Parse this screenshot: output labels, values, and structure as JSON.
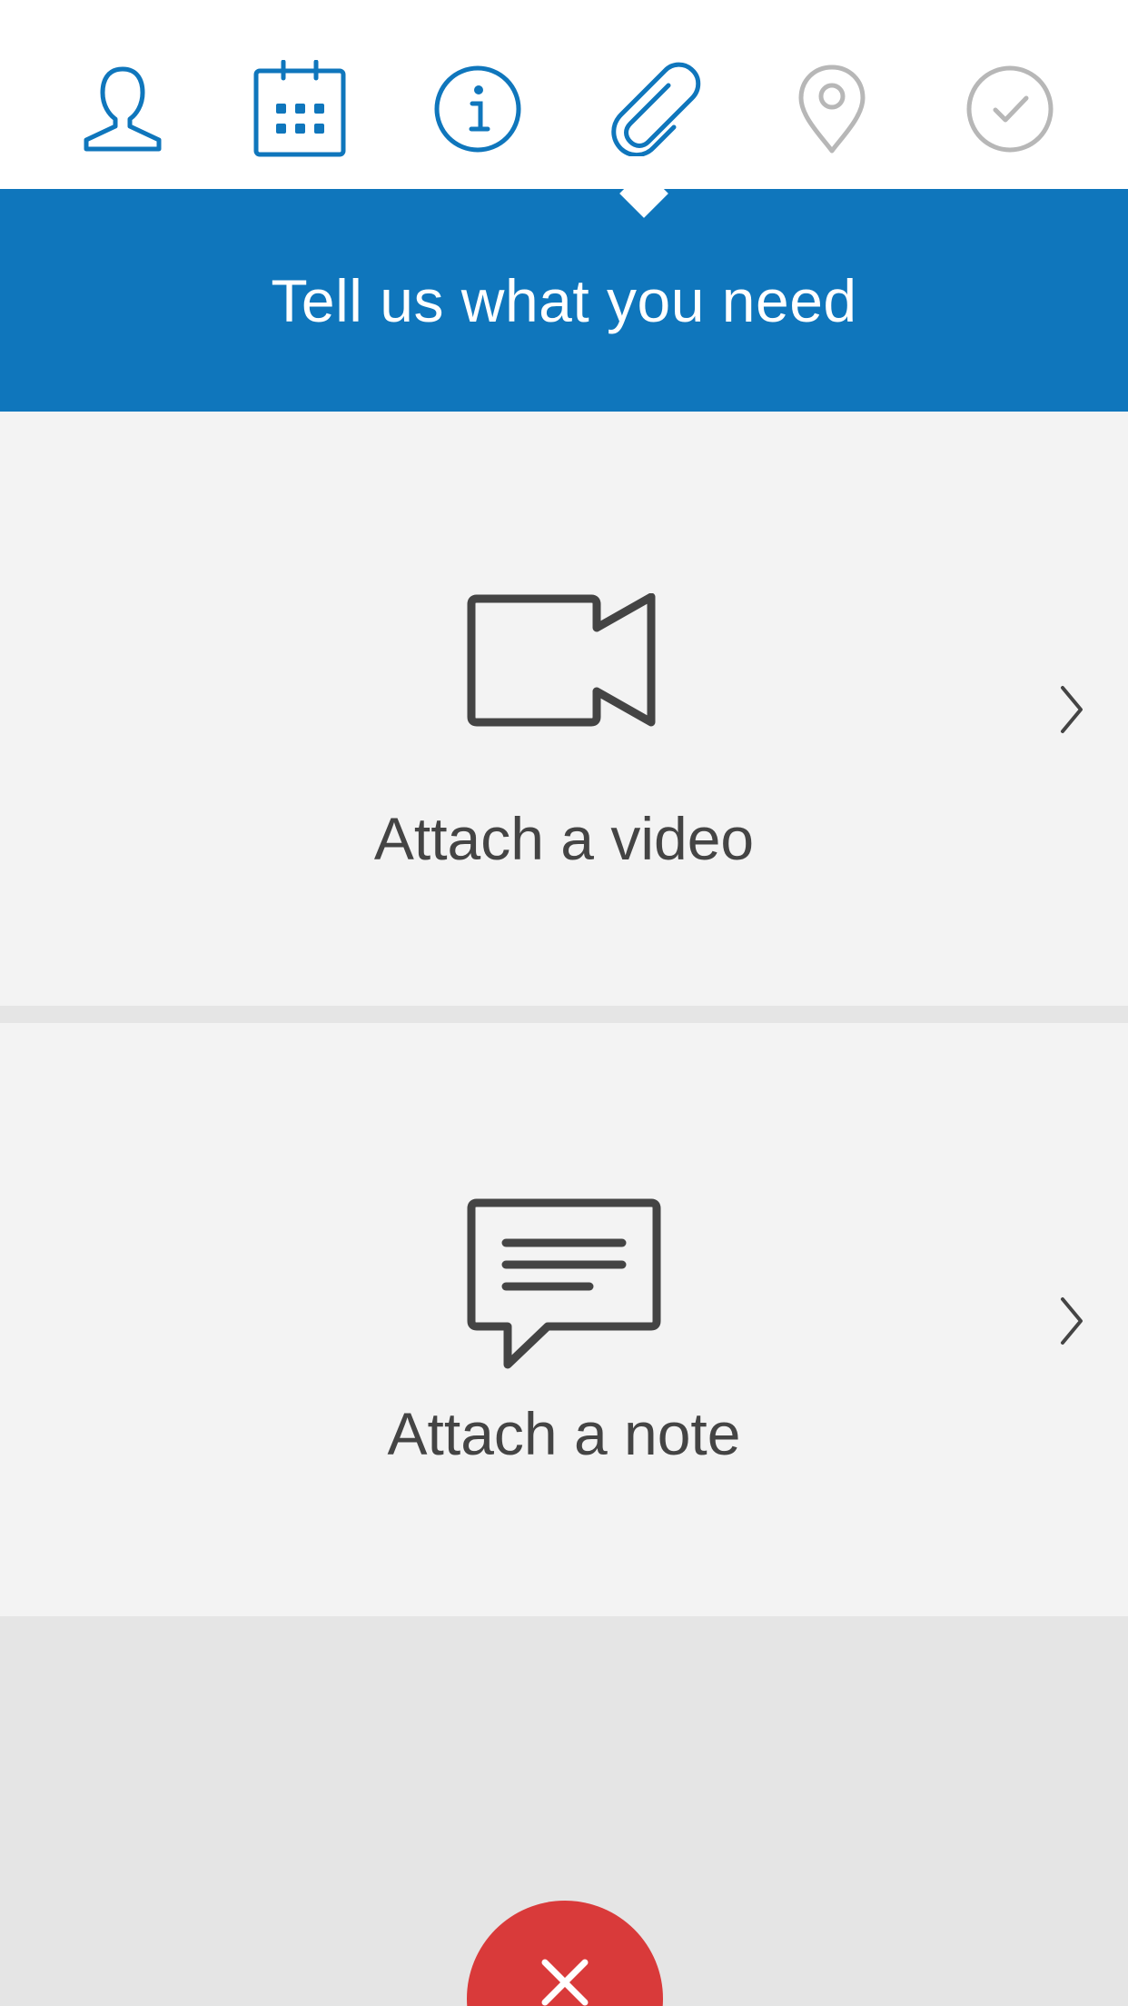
{
  "steps": [
    {
      "name": "profile",
      "icon": "user-icon",
      "state": "done",
      "color": "#0f76bc"
    },
    {
      "name": "calendar",
      "icon": "calendar-icon",
      "state": "done",
      "color": "#0f76bc"
    },
    {
      "name": "info",
      "icon": "info-icon",
      "state": "done",
      "color": "#0f76bc"
    },
    {
      "name": "attachments",
      "icon": "paperclip-icon",
      "state": "active",
      "color": "#0f76bc"
    },
    {
      "name": "location",
      "icon": "location-pin-icon",
      "state": "pending",
      "color": "#b7b7b7"
    },
    {
      "name": "confirm",
      "icon": "checkmark-circle-icon",
      "state": "pending",
      "color": "#b7b7b7"
    }
  ],
  "header": {
    "title": "Tell us what you need"
  },
  "options": [
    {
      "label": "Attach a video",
      "icon": "video-camera-icon"
    },
    {
      "label": "Attach a note",
      "icon": "speech-bubble-icon"
    }
  ],
  "close_button": {
    "icon": "close-icon"
  },
  "colors": {
    "brand_blue": "#0f76bc",
    "inactive_gray": "#b7b7b7",
    "card_bg": "#f3f3f3",
    "page_bg": "#e5e5e5",
    "icon_dark": "#444444",
    "danger_red": "#d93a3a"
  }
}
